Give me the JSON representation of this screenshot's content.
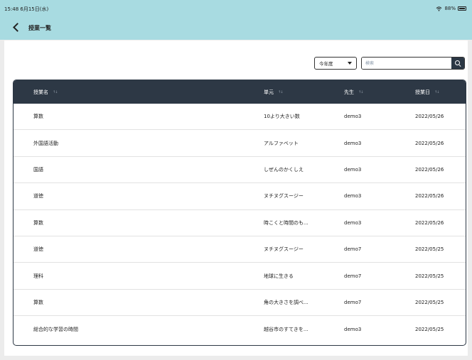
{
  "status_bar": {
    "time_date": "15:48  6月15日(水)",
    "battery_text": "88%"
  },
  "header": {
    "title": "授業一覧",
    "back_icon": "chevron-left-icon"
  },
  "filters": {
    "year_selected": "今年度",
    "search_placeholder": "検索"
  },
  "table": {
    "columns": [
      "授業名",
      "単元",
      "先生",
      "授業日"
    ],
    "sort_glyph": "↑↓",
    "rows": [
      {
        "subject": "算数",
        "unit": "10より大きい数",
        "teacher": "demo3",
        "date": "2022/05/26"
      },
      {
        "subject": "外国語活動",
        "unit": "アルファベット",
        "teacher": "demo3",
        "date": "2022/05/26"
      },
      {
        "subject": "国語",
        "unit": "しぜんのかくしえ",
        "teacher": "demo3",
        "date": "2022/05/26"
      },
      {
        "subject": "道徳",
        "unit": "ヌチヌグスージー",
        "teacher": "demo3",
        "date": "2022/05/26"
      },
      {
        "subject": "算数",
        "unit": "時こくと時間のも...",
        "teacher": "demo3",
        "date": "2022/05/26"
      },
      {
        "subject": "道徳",
        "unit": "ヌチヌグスージー",
        "teacher": "demo7",
        "date": "2022/05/25"
      },
      {
        "subject": "理科",
        "unit": "地球に生きる",
        "teacher": "demo7",
        "date": "2022/05/25"
      },
      {
        "subject": "算数",
        "unit": "角の大きさを調べ...",
        "teacher": "demo7",
        "date": "2022/05/25"
      },
      {
        "subject": "総合的な学習の時間",
        "unit": "越谷市のすてきを...",
        "teacher": "demo3",
        "date": "2022/05/25"
      }
    ]
  },
  "colors": {
    "header_bg": "#a8dbe1",
    "table_header_bg": "#2d3845",
    "page_bg": "#ececec"
  }
}
